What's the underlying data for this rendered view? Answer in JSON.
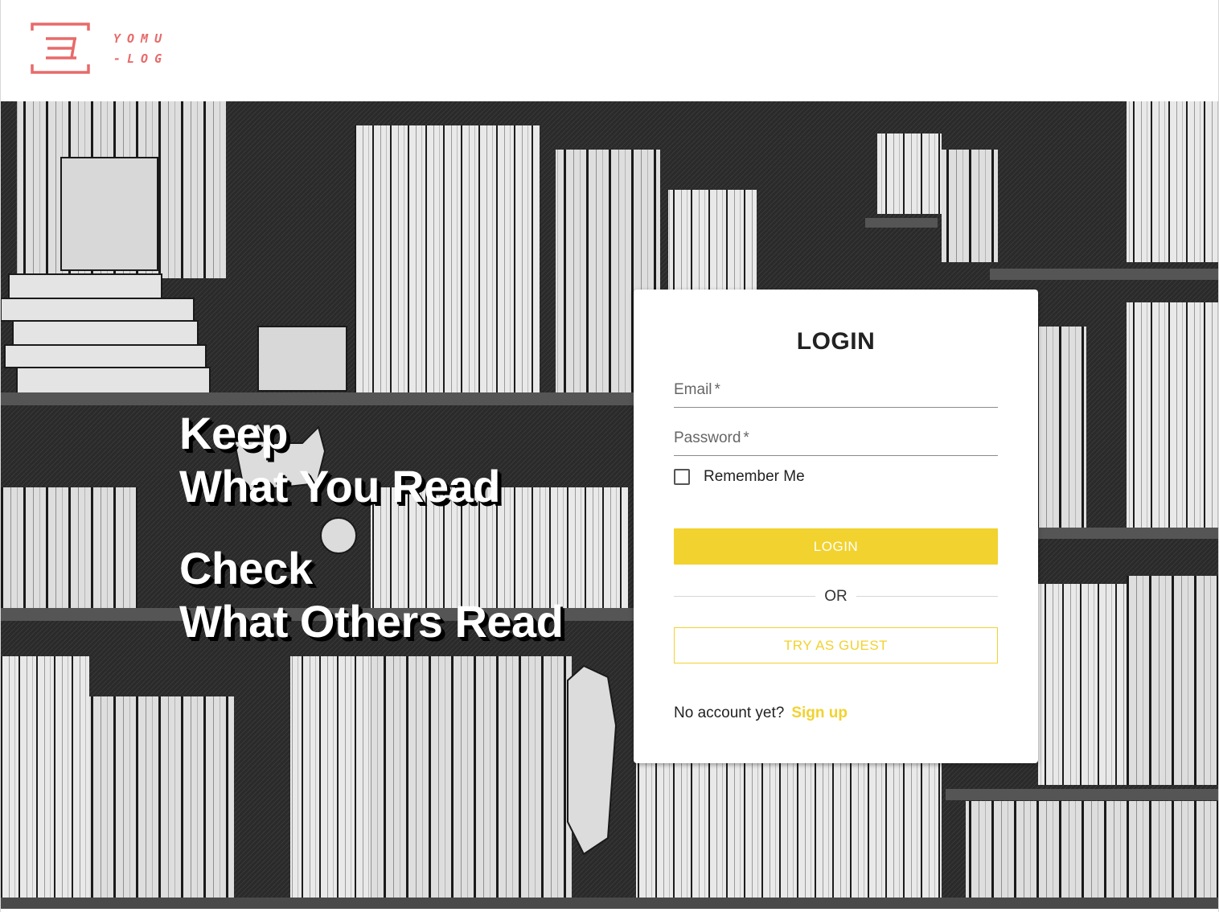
{
  "header": {
    "logo_text_line1": "YOMU",
    "logo_text_line2": "-LOG",
    "logo_color": "#e86a6a"
  },
  "hero": {
    "tagline1": [
      "Keep",
      "What You Read"
    ],
    "tagline2": [
      "Check",
      "What Others Read"
    ],
    "background_description": "black and white sketch of bookshelves with cats"
  },
  "login_card": {
    "title": "LOGIN",
    "email_label": "Email",
    "email_required_mark": "*",
    "password_label": "Password",
    "password_required_mark": "*",
    "remember_label": "Remember Me",
    "remember_checked": false,
    "login_button": "LOGIN",
    "divider_text": "OR",
    "guest_button": "TRY AS GUEST",
    "no_account_text": "No account yet?",
    "signup_link": "Sign up"
  },
  "colors": {
    "accent": "#f2d22e",
    "brand": "#e86a6a"
  }
}
